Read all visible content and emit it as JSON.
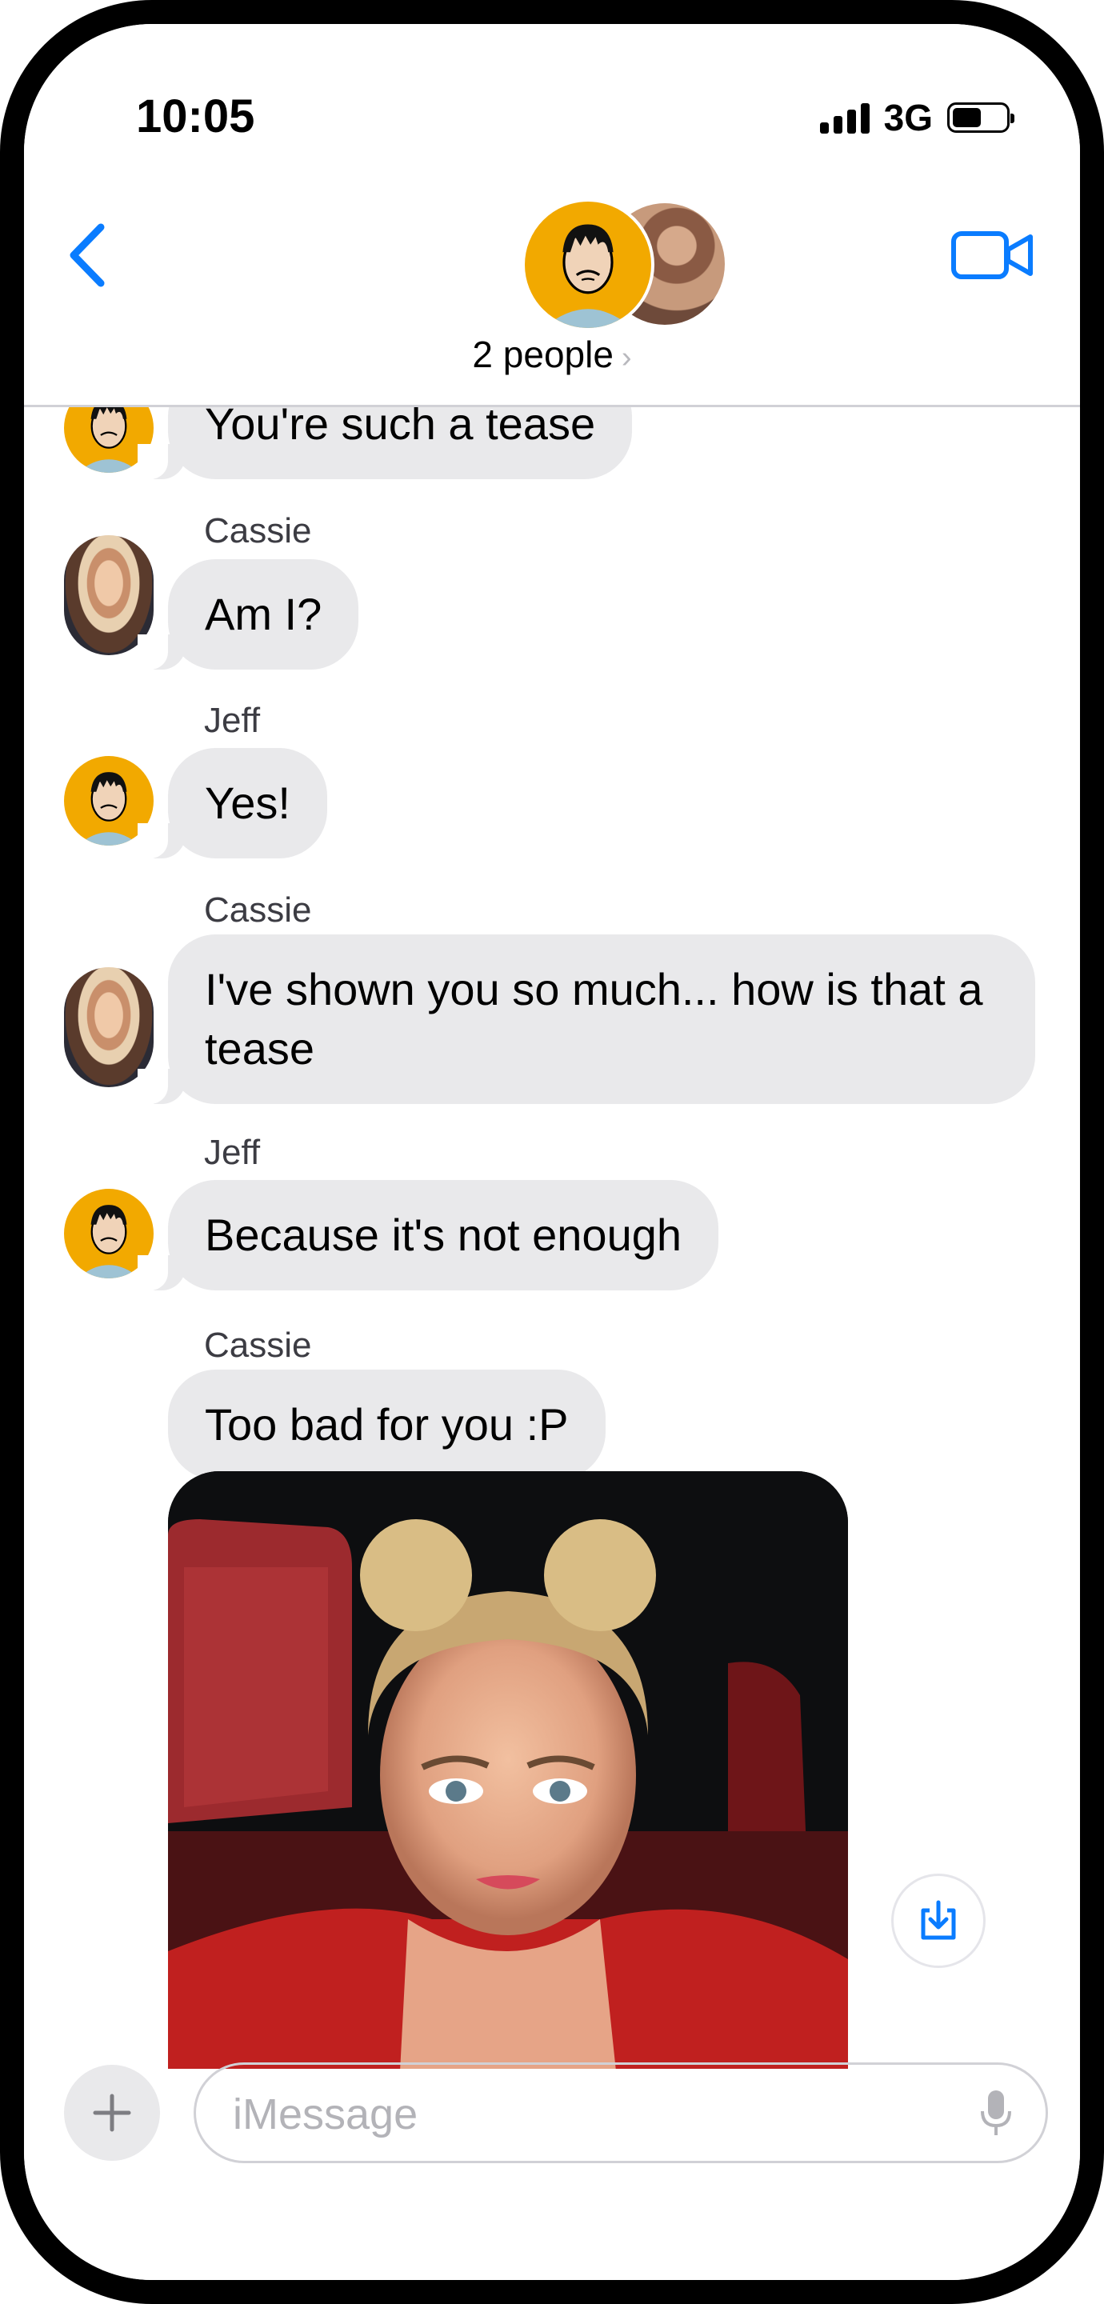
{
  "status_bar": {
    "time": "10:05",
    "network": "3G",
    "icons": [
      "signal-bars-icon",
      "battery-icon"
    ]
  },
  "header": {
    "group_label": "2 people",
    "chevron": "›",
    "icons": [
      "back-chevron-icon",
      "video-camera-icon"
    ]
  },
  "messages": [
    {
      "sender": "Jeff",
      "text": "You're such a tease",
      "show_sender": false
    },
    {
      "sender": "Cassie",
      "text": "Am I?"
    },
    {
      "sender": "Jeff",
      "text": "Yes!"
    },
    {
      "sender": "Cassie",
      "text": "I've shown you so much... how is that a tease"
    },
    {
      "sender": "Jeff",
      "text": "Because it's not enough"
    },
    {
      "sender": "Cassie",
      "text": "Too bad for you :P"
    }
  ],
  "attachment": {
    "type": "photo",
    "action_icon": "save-download-icon"
  },
  "compose": {
    "placeholder": "iMessage",
    "value": "",
    "icons": [
      "plus-icon",
      "microphone-icon"
    ]
  },
  "colors": {
    "accent": "#0a7cff",
    "bubble_gray": "#e9e9eb",
    "jeff_avatar": "#f2a900"
  }
}
